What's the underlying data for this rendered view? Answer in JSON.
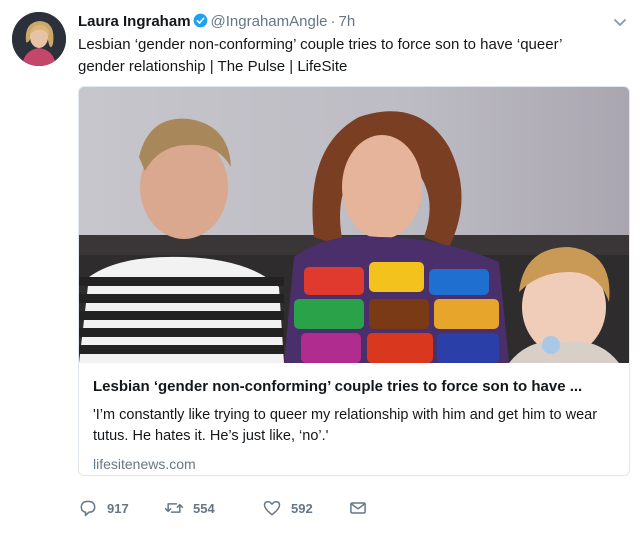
{
  "user": {
    "display_name": "Laura Ingraham",
    "handle": "@IngrahamAngle",
    "time": "7h",
    "verified": true
  },
  "tweet": {
    "text": "Lesbian ‘gender non-conforming’ couple tries to force son to have ‘queer’ gender relationship | The Pulse | LifeSite"
  },
  "card": {
    "title": "Lesbian ‘gender non-conforming’ couple tries to force son to have ...",
    "description": "'I’m constantly like trying to queer my relationship with him and get him to wear tutus. He hates it. He’s just like, ‘no’.'",
    "domain": "lifesitenews.com"
  },
  "actions": {
    "reply_count": "917",
    "retweet_count": "554",
    "like_count": "592"
  },
  "icons": {
    "reply": "reply-icon",
    "retweet": "retweet-icon",
    "like": "heart-icon",
    "dm": "envelope-icon",
    "caret": "chevron-down-icon",
    "verified": "verified-badge-icon"
  },
  "colors": {
    "verified": "#1da1f2",
    "secondary_text": "#657786",
    "border": "#e1e8ed"
  }
}
